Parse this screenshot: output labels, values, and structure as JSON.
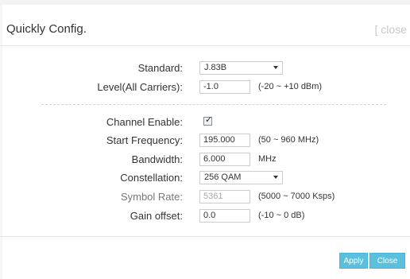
{
  "dialog": {
    "title": "Quickly Config.",
    "close_link": "[ close"
  },
  "form": {
    "standard": {
      "label": "Standard:",
      "value": "J.83B"
    },
    "level": {
      "label": "Level(All Carriers):",
      "value": "-1.0",
      "hint": "(-20 ~ +10 dBm)"
    },
    "channel_enable": {
      "label": "Channel Enable:",
      "checked": true
    },
    "start_frequency": {
      "label": "Start Frequency:",
      "value": "195.000",
      "hint": "(50 ~ 960 MHz)"
    },
    "bandwidth": {
      "label": "Bandwidth:",
      "value": "6.000",
      "hint": "MHz"
    },
    "constellation": {
      "label": "Constellation:",
      "value": "256 QAM"
    },
    "symbol_rate": {
      "label": "Symbol Rate:",
      "value": "5361",
      "hint": "(5000 ~ 7000 Ksps)"
    },
    "gain_offset": {
      "label": "Gain offset:",
      "value": "0.0",
      "hint": "(-10 ~ 0 dB)"
    }
  },
  "footer": {
    "apply_label": "Apply",
    "close_label": "Close"
  },
  "colors": {
    "button": "#5bc0de",
    "close_link": "#c8c8c8"
  }
}
